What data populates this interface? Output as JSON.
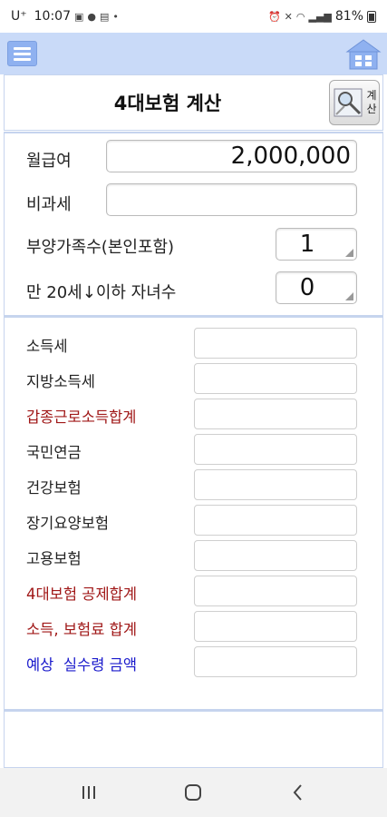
{
  "status_bar": {
    "carrier": "U⁺",
    "time": "10:07",
    "battery": "81%"
  },
  "appbar": {
    "menu_icon": "hamburger-menu-icon",
    "home_icon": "home-icon"
  },
  "header": {
    "title": "4대보험 계산",
    "calc_button_label_1": "계",
    "calc_button_label_2": "산"
  },
  "inputs": {
    "salary_label": "월급여",
    "salary_value": "2,000,000",
    "nontax_label": "비과세",
    "nontax_value": "",
    "dependents_label": "부양가족수(본인포함)",
    "dependents_value": "1",
    "children_label": "만 20세↓이하 자녀수",
    "children_value": "0"
  },
  "results": [
    {
      "label": "소득세",
      "color": "normal"
    },
    {
      "label": "지방소득세",
      "color": "normal"
    },
    {
      "label": "갑종근로소득합계",
      "color": "red"
    },
    {
      "label": "국민연금",
      "color": "normal"
    },
    {
      "label": "건강보험",
      "color": "normal"
    },
    {
      "label": "장기요양보험",
      "color": "normal"
    },
    {
      "label": "고용보험",
      "color": "normal"
    },
    {
      "label": "4대보험 공제합계",
      "color": "red"
    },
    {
      "label": "소득, 보험료 합계",
      "color": "red"
    },
    {
      "label": "예상  실수령 금액",
      "color": "blue"
    }
  ],
  "colors": {
    "appbar": "#c9daf8",
    "panel_border": "#c6d4ee",
    "red_label": "#a01818",
    "blue_label": "#1a1acc"
  }
}
